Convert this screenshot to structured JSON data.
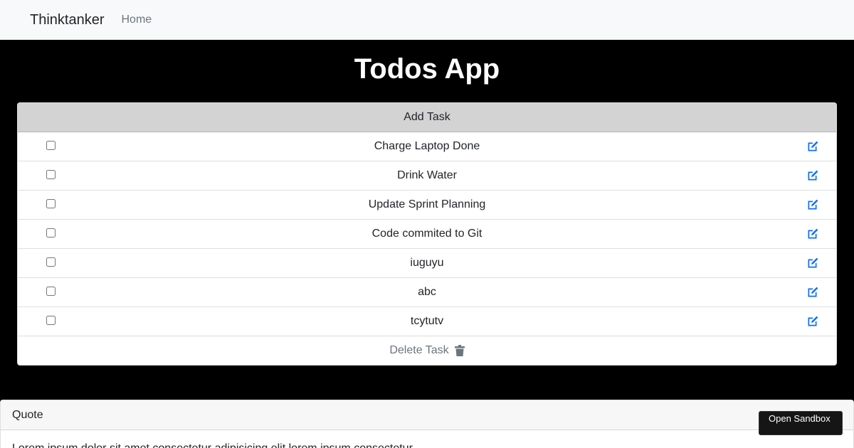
{
  "navbar": {
    "brand": "Thinktanker",
    "home_link": "Home"
  },
  "app": {
    "title": "Todos App"
  },
  "todo_card": {
    "add_task_label": "Add Task",
    "tasks": [
      {
        "text": "Charge Laptop Done"
      },
      {
        "text": "Drink Water"
      },
      {
        "text": "Update Sprint Planning"
      },
      {
        "text": "Code commited to Git"
      },
      {
        "text": "iuguyu"
      },
      {
        "text": "abc"
      },
      {
        "text": "tcytutv"
      }
    ],
    "delete_label": "Delete Task"
  },
  "quote": {
    "header": "Quote",
    "body": "Lorem ipsum dolor sit amet consectetur adipisicing elit lorem ipsum consectetur"
  },
  "sandbox": {
    "label": "Open Sandbox"
  },
  "icons": {
    "edit": "edit-icon",
    "trash": "trash-icon"
  },
  "colors": {
    "edit_icon": "#0d6efd",
    "header_bg": "#d3d3d3",
    "page_bg": "#000000"
  }
}
